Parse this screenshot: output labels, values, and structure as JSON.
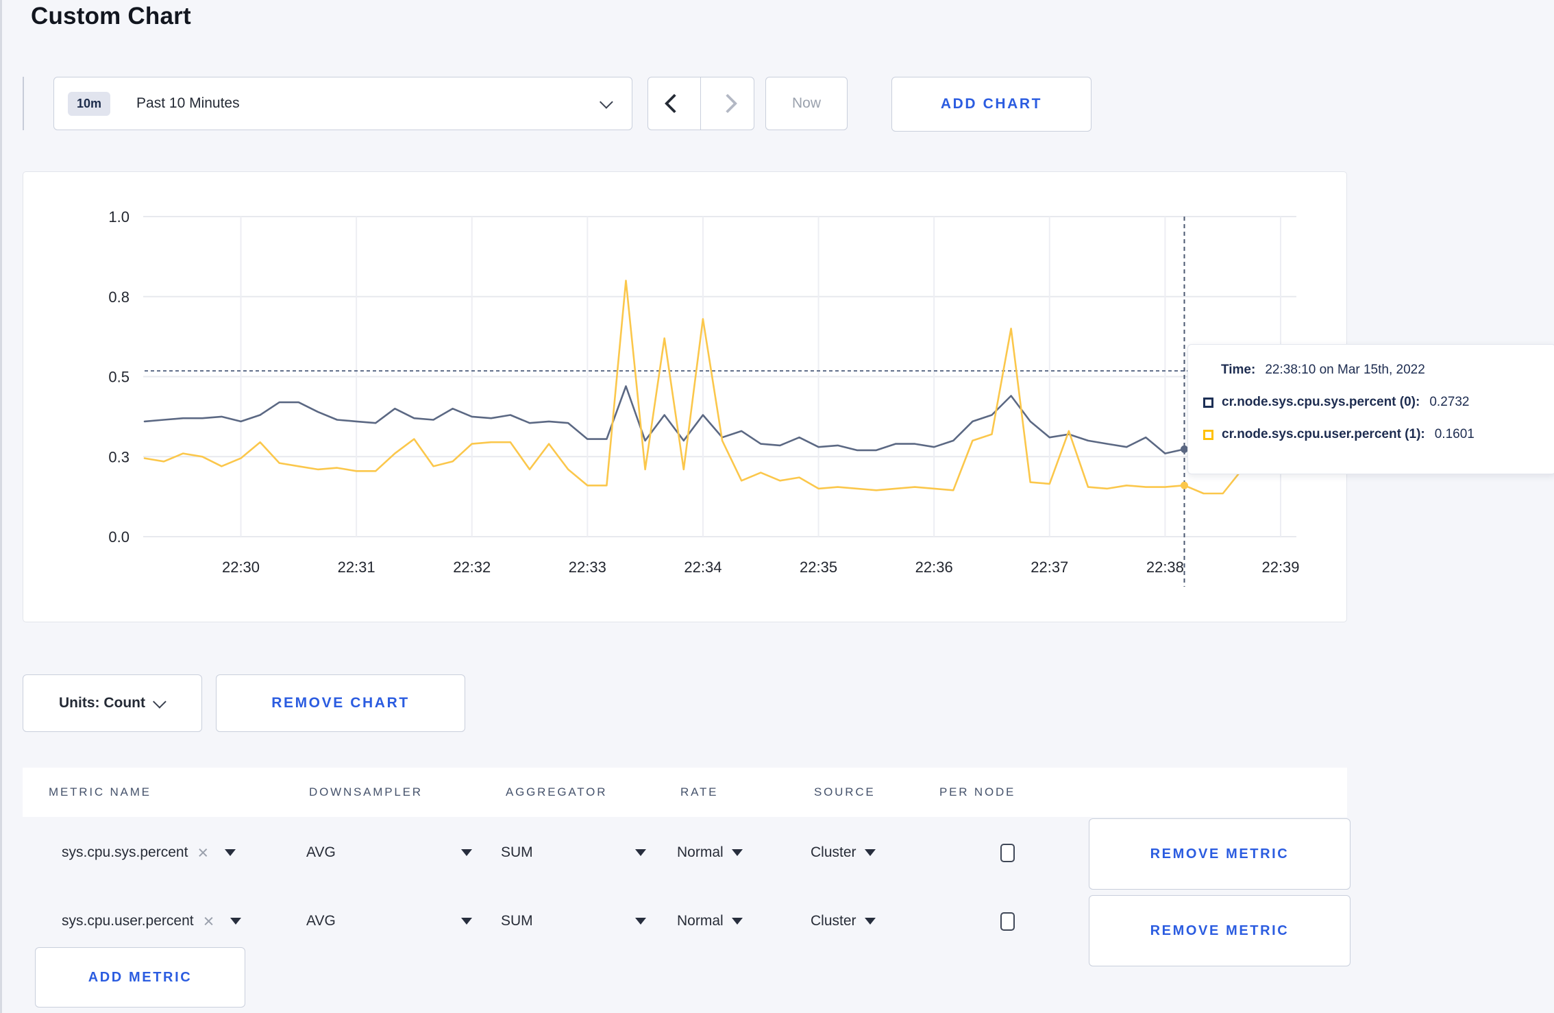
{
  "page": {
    "title": "Custom Chart"
  },
  "toolbar": {
    "time_window_badge": "10m",
    "time_window_label": "Past 10 Minutes",
    "now_label": "Now",
    "add_chart_label": "ADD CHART"
  },
  "chart_data": {
    "type": "line",
    "title": "",
    "ylim": [
      0,
      1
    ],
    "grid": true,
    "legend_position": "tooltip-only",
    "y_ticks": [
      {
        "v": 0,
        "label": "0.0"
      },
      {
        "v": 0.25,
        "label": "0.3"
      },
      {
        "v": 0.5,
        "label": "0.5"
      },
      {
        "v": 0.75,
        "label": "0.8"
      },
      {
        "v": 1,
        "label": "1.0"
      }
    ],
    "x_times": [
      "22:29:10",
      "22:29:20",
      "22:29:30",
      "22:29:40",
      "22:29:50",
      "22:30:00",
      "22:30:10",
      "22:30:20",
      "22:30:30",
      "22:30:40",
      "22:30:50",
      "22:31:00",
      "22:31:10",
      "22:31:20",
      "22:31:30",
      "22:31:40",
      "22:31:50",
      "22:32:00",
      "22:32:10",
      "22:32:20",
      "22:32:30",
      "22:32:40",
      "22:32:50",
      "22:33:00",
      "22:33:10",
      "22:33:20",
      "22:33:30",
      "22:33:40",
      "22:33:50",
      "22:34:00",
      "22:34:10",
      "22:34:20",
      "22:34:30",
      "22:34:40",
      "22:34:50",
      "22:35:00",
      "22:35:10",
      "22:35:20",
      "22:35:30",
      "22:35:40",
      "22:35:50",
      "22:36:00",
      "22:36:10",
      "22:36:20",
      "22:36:30",
      "22:36:40",
      "22:36:50",
      "22:37:00",
      "22:37:10",
      "22:37:20",
      "22:37:30",
      "22:37:40",
      "22:37:50",
      "22:38:00",
      "22:38:10",
      "22:38:20",
      "22:38:30",
      "22:38:40",
      "22:38:50",
      "22:39:00"
    ],
    "x_tick_indices": [
      5,
      11,
      17,
      23,
      29,
      35,
      41,
      47,
      53,
      59
    ],
    "x_tick_labels": [
      "22:30",
      "22:31",
      "22:32",
      "22:33",
      "22:34",
      "22:35",
      "22:36",
      "22:37",
      "22:38",
      "22:39"
    ],
    "series": [
      {
        "name": "cr.node.sys.cpu.sys.percent (0)",
        "color": "#5b6883",
        "values": [
          0.36,
          0.365,
          0.37,
          0.37,
          0.375,
          0.36,
          0.38,
          0.42,
          0.42,
          0.39,
          0.365,
          0.36,
          0.355,
          0.4,
          0.37,
          0.365,
          0.4,
          0.375,
          0.37,
          0.38,
          0.355,
          0.36,
          0.355,
          0.305,
          0.305,
          0.47,
          0.3,
          0.38,
          0.3,
          0.38,
          0.31,
          0.33,
          0.29,
          0.285,
          0.31,
          0.28,
          0.285,
          0.27,
          0.27,
          0.29,
          0.29,
          0.28,
          0.3,
          0.36,
          0.38,
          0.44,
          0.36,
          0.31,
          0.32,
          0.3,
          0.29,
          0.28,
          0.31,
          0.26,
          0.2732,
          0.26,
          0.27,
          0.28,
          0.3,
          0.31
        ]
      },
      {
        "name": "cr.node.sys.cpu.user.percent (1)",
        "color": "#fbc74b",
        "values": [
          0.245,
          0.235,
          0.26,
          0.25,
          0.22,
          0.245,
          0.295,
          0.23,
          0.22,
          0.21,
          0.215,
          0.205,
          0.205,
          0.26,
          0.305,
          0.22,
          0.235,
          0.29,
          0.295,
          0.295,
          0.21,
          0.29,
          0.21,
          0.16,
          0.16,
          0.8,
          0.21,
          0.62,
          0.21,
          0.68,
          0.3,
          0.175,
          0.2,
          0.175,
          0.185,
          0.15,
          0.155,
          0.15,
          0.145,
          0.15,
          0.155,
          0.15,
          0.145,
          0.3,
          0.32,
          0.65,
          0.17,
          0.165,
          0.33,
          0.155,
          0.15,
          0.16,
          0.155,
          0.155,
          0.1601,
          0.135,
          0.135,
          0.21,
          0.28,
          0.21
        ]
      }
    ],
    "hover_line_value": 0.518,
    "crosshair": {
      "index": 54,
      "time": "22:38:10"
    }
  },
  "tooltip": {
    "time_label": "Time:",
    "time_value": "22:38:10 on Mar 15th, 2022",
    "series": [
      {
        "label": "cr.node.sys.cpu.sys.percent (0):",
        "value": "0.2732",
        "color": "#1c2f55"
      },
      {
        "label": "cr.node.sys.cpu.user.percent (1):",
        "value": "0.1601",
        "color": "#ffc107"
      }
    ]
  },
  "chart_controls": {
    "units_label": "Units: Count",
    "remove_chart_label": "REMOVE CHART"
  },
  "metrics_table": {
    "headers": [
      "METRIC NAME",
      "DOWNSAMPLER",
      "AGGREGATOR",
      "RATE",
      "SOURCE",
      "PER NODE"
    ],
    "rows": [
      {
        "metric": "sys.cpu.sys.percent",
        "downsampler": "AVG",
        "aggregator": "SUM",
        "rate": "Normal",
        "source": "Cluster",
        "per_node": false,
        "remove_label": "REMOVE METRIC"
      },
      {
        "metric": "sys.cpu.user.percent",
        "downsampler": "AVG",
        "aggregator": "SUM",
        "rate": "Normal",
        "source": "Cluster",
        "per_node": false,
        "remove_label": "REMOVE METRIC"
      }
    ],
    "add_metric_label": "ADD METRIC"
  }
}
